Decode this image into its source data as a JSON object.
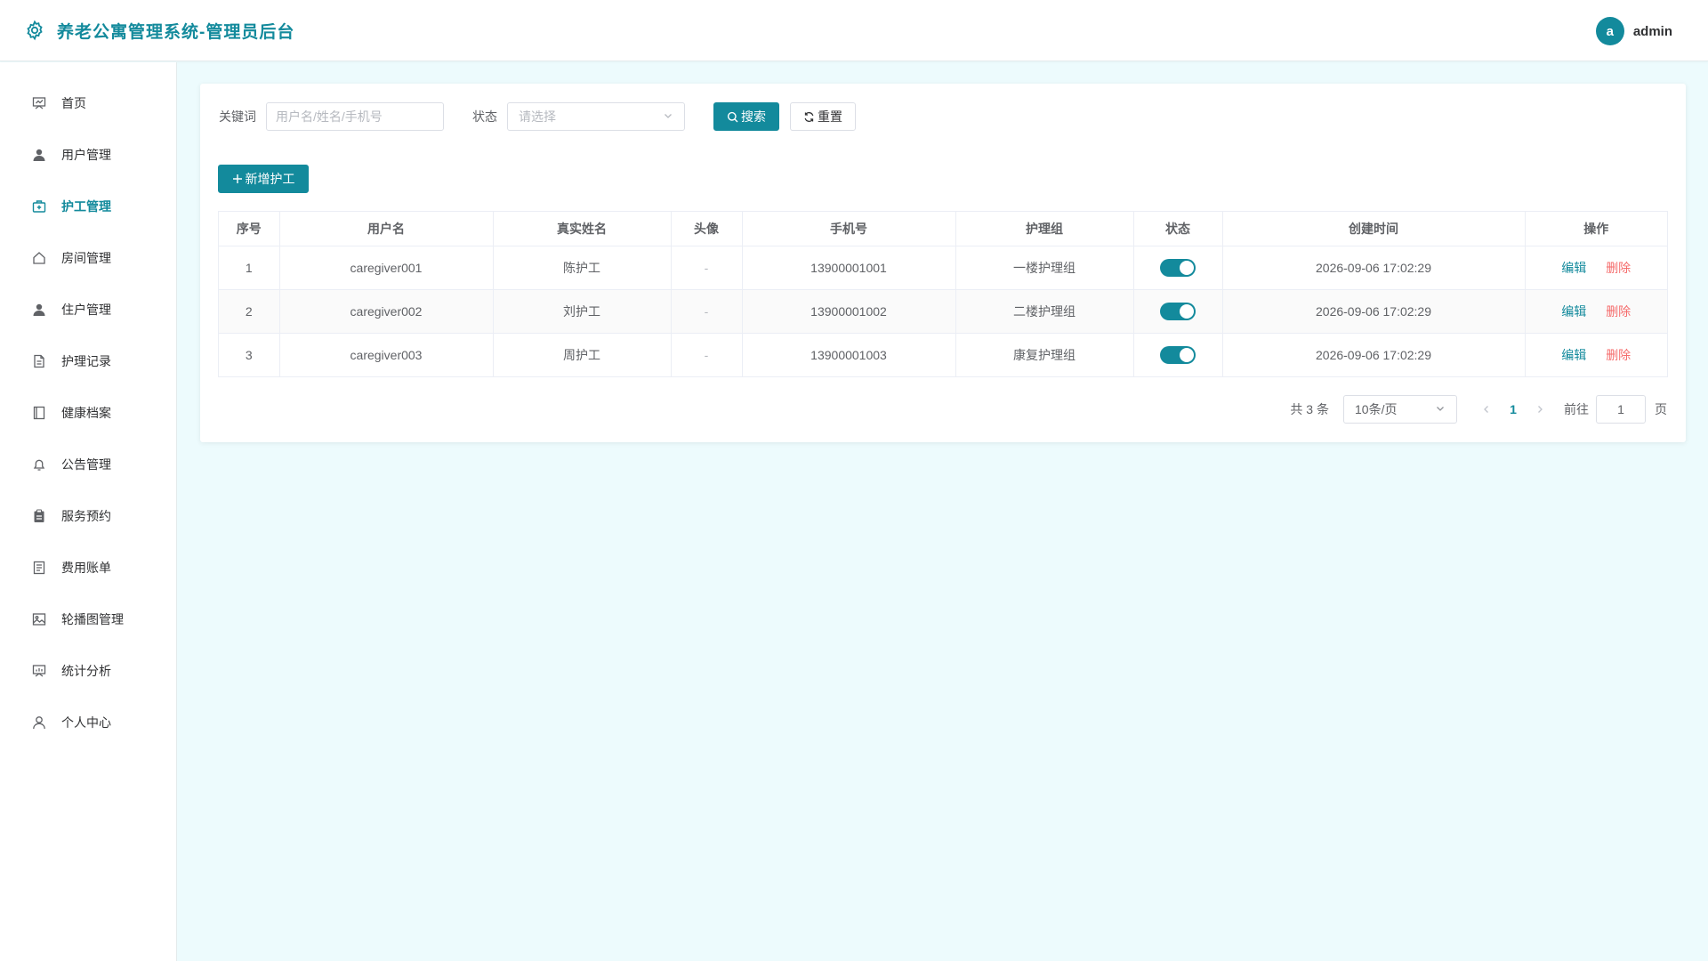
{
  "header": {
    "title": "养老公寓管理系统-管理员后台",
    "avatar_letter": "a",
    "username": "admin",
    "accent": "#138a9c"
  },
  "sidebar": {
    "items": [
      {
        "label": "首页",
        "icon": "dashboard-icon",
        "active": false
      },
      {
        "label": "用户管理",
        "icon": "user-icon",
        "active": false
      },
      {
        "label": "护工管理",
        "icon": "first-aid-kit-icon",
        "active": true
      },
      {
        "label": "房间管理",
        "icon": "house-icon",
        "active": false
      },
      {
        "label": "住户管理",
        "icon": "resident-icon",
        "active": false
      },
      {
        "label": "护理记录",
        "icon": "document-icon",
        "active": false
      },
      {
        "label": "健康档案",
        "icon": "notebook-icon",
        "active": false
      },
      {
        "label": "公告管理",
        "icon": "bell-icon",
        "active": false
      },
      {
        "label": "服务预约",
        "icon": "clipboard-icon",
        "active": false
      },
      {
        "label": "费用账单",
        "icon": "bill-icon",
        "active": false
      },
      {
        "label": "轮播图管理",
        "icon": "picture-icon",
        "active": false
      },
      {
        "label": "统计分析",
        "icon": "chart-board-icon",
        "active": false
      },
      {
        "label": "个人中心",
        "icon": "person-outline-icon",
        "active": false
      }
    ]
  },
  "filters": {
    "keyword_label": "关键词",
    "keyword_placeholder": "用户名/姓名/手机号",
    "keyword_value": "",
    "status_label": "状态",
    "status_placeholder": "请选择",
    "search_label": "搜索",
    "reset_label": "重置"
  },
  "actions": {
    "add_label": "新增护工"
  },
  "table": {
    "columns": [
      "序号",
      "用户名",
      "真实姓名",
      "头像",
      "手机号",
      "护理组",
      "状态",
      "创建时间",
      "操作"
    ],
    "rows": [
      {
        "index": "1",
        "username": "caregiver001",
        "real_name": "陈护工",
        "avatar": "-",
        "phone": "13900001001",
        "group": "一楼护理组",
        "status_on": true,
        "created": "2026-09-06 17:02:29"
      },
      {
        "index": "2",
        "username": "caregiver002",
        "real_name": "刘护工",
        "avatar": "-",
        "phone": "13900001002",
        "group": "二楼护理组",
        "status_on": true,
        "created": "2026-09-06 17:02:29"
      },
      {
        "index": "3",
        "username": "caregiver003",
        "real_name": "周护工",
        "avatar": "-",
        "phone": "13900001003",
        "group": "康复护理组",
        "status_on": true,
        "created": "2026-09-06 17:02:29"
      }
    ],
    "edit_label": "编辑",
    "delete_label": "删除"
  },
  "pagination": {
    "total_text": "共 3 条",
    "page_size": "10条/页",
    "current_page": "1",
    "goto_label": "前往",
    "goto_value": "1",
    "page_suffix": "页"
  }
}
